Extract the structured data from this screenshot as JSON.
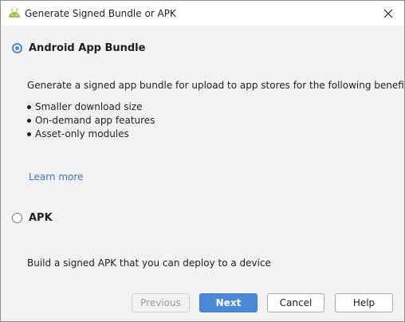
{
  "window": {
    "title": "Generate Signed Bundle or APK",
    "app_icon": "android-icon",
    "close_icon": "close-icon"
  },
  "options": {
    "bundle": {
      "label": "Android App Bundle",
      "selected": true,
      "description": "Generate a signed app bundle for upload to app stores for the following benefits:",
      "benefits": [
        "Smaller download size",
        "On-demand app features",
        "Asset-only modules"
      ],
      "learn_more": "Learn more"
    },
    "apk": {
      "label": "APK",
      "selected": false,
      "description": "Build a signed APK that you can deploy to a device"
    }
  },
  "buttons": {
    "previous": "Previous",
    "next": "Next",
    "cancel": "Cancel",
    "help": "Help"
  },
  "colors": {
    "accent": "#4a89d8",
    "link": "#3b73b9",
    "android_green": "#9bc450"
  }
}
